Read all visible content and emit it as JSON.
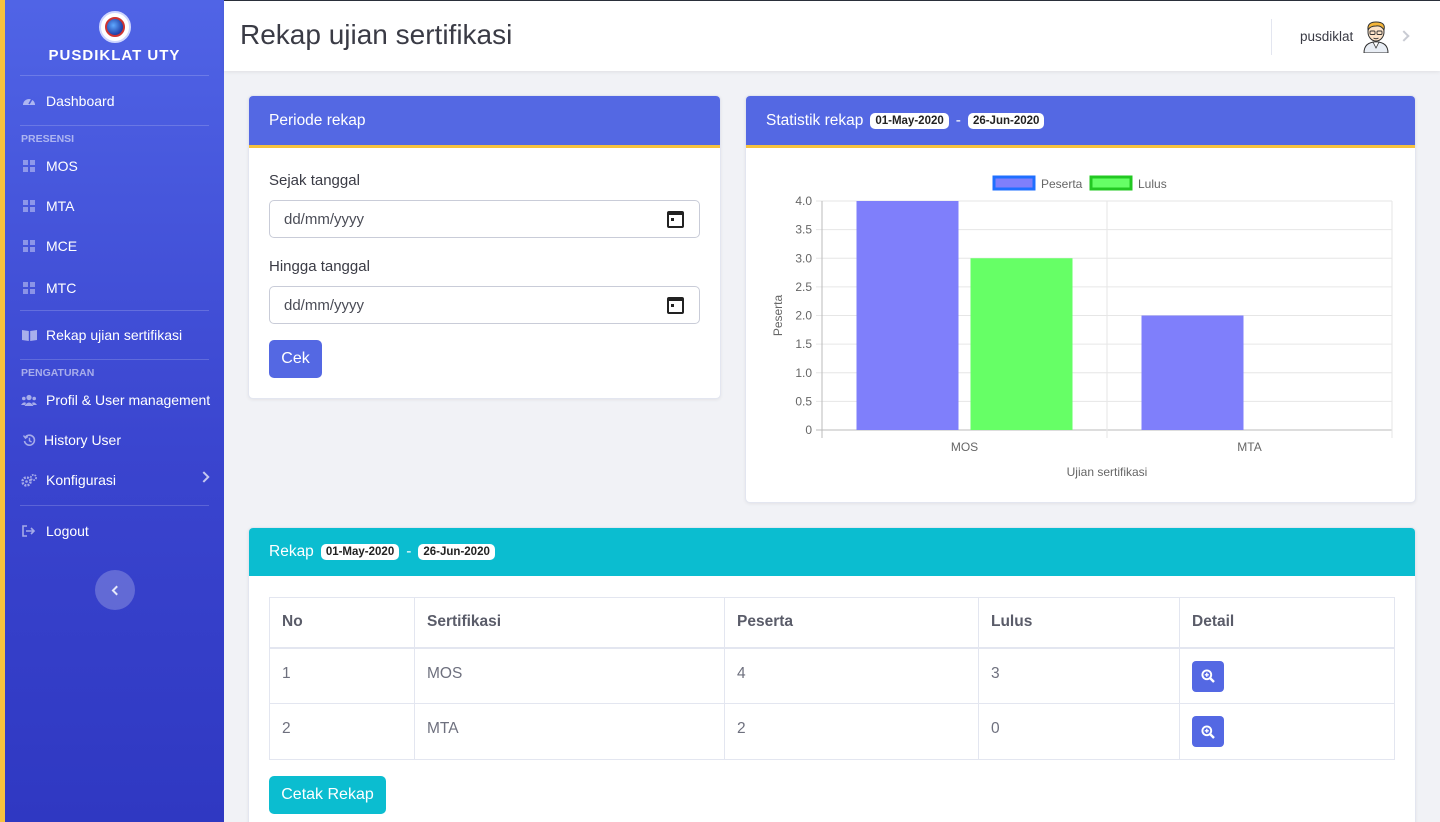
{
  "sidebar": {
    "brand": "PUSDIKLAT UTY",
    "dashboard": "Dashboard",
    "presensi_heading": "PRESENSI",
    "presensi_items": [
      "MOS",
      "MTA",
      "MCE",
      "MTC"
    ],
    "rekap": "Rekap ujian sertifikasi",
    "pengaturan_heading": "PENGATURAN",
    "profil": "Profil & User management",
    "history": "History User",
    "konfigurasi": "Konfigurasi",
    "logout": "Logout"
  },
  "topbar": {
    "title": "Rekap ujian sertifikasi",
    "user": "pusdiklat"
  },
  "periode": {
    "title": "Periode rekap",
    "since_label": "Sejak tanggal",
    "since_placeholder": "dd/mm/yyyy",
    "until_label": "Hingga tanggal",
    "until_placeholder": "dd/mm/yyyy",
    "cek_button": "Cek"
  },
  "statistik": {
    "title": "Statistik rekap",
    "date_from": "01-May-2020",
    "date_sep": "-",
    "date_to": "26-Jun-2020"
  },
  "chart_data": {
    "type": "bar",
    "categories": [
      "MOS",
      "MTA"
    ],
    "series": [
      {
        "name": "Peserta",
        "values": [
          4,
          2
        ],
        "color": "#7f7ffb"
      },
      {
        "name": "Lulus",
        "values": [
          3,
          0
        ],
        "color": "#66ff66"
      }
    ],
    "xlabel": "Ujian sertifikasi",
    "ylabel": "Peserta",
    "ylim": [
      0,
      4
    ],
    "yticks": [
      "0",
      "0.5",
      "1.0",
      "1.5",
      "2.0",
      "2.5",
      "3.0",
      "3.5",
      "4.0"
    ],
    "legend": "top",
    "grid": true
  },
  "rekap": {
    "title": "Rekap",
    "date_from": "01-May-2020",
    "date_sep": "-",
    "date_to": "26-Jun-2020",
    "columns": [
      "No",
      "Sertifikasi",
      "Peserta",
      "Lulus",
      "Detail"
    ],
    "rows": [
      {
        "no": "1",
        "sertifikasi": "MOS",
        "peserta": "4",
        "lulus": "3"
      },
      {
        "no": "2",
        "sertifikasi": "MTA",
        "peserta": "2",
        "lulus": "0"
      }
    ],
    "print_button": "Cetak Rekap"
  },
  "icons": {
    "detail": "zoom-in-icon",
    "menu": "grid-icon"
  }
}
